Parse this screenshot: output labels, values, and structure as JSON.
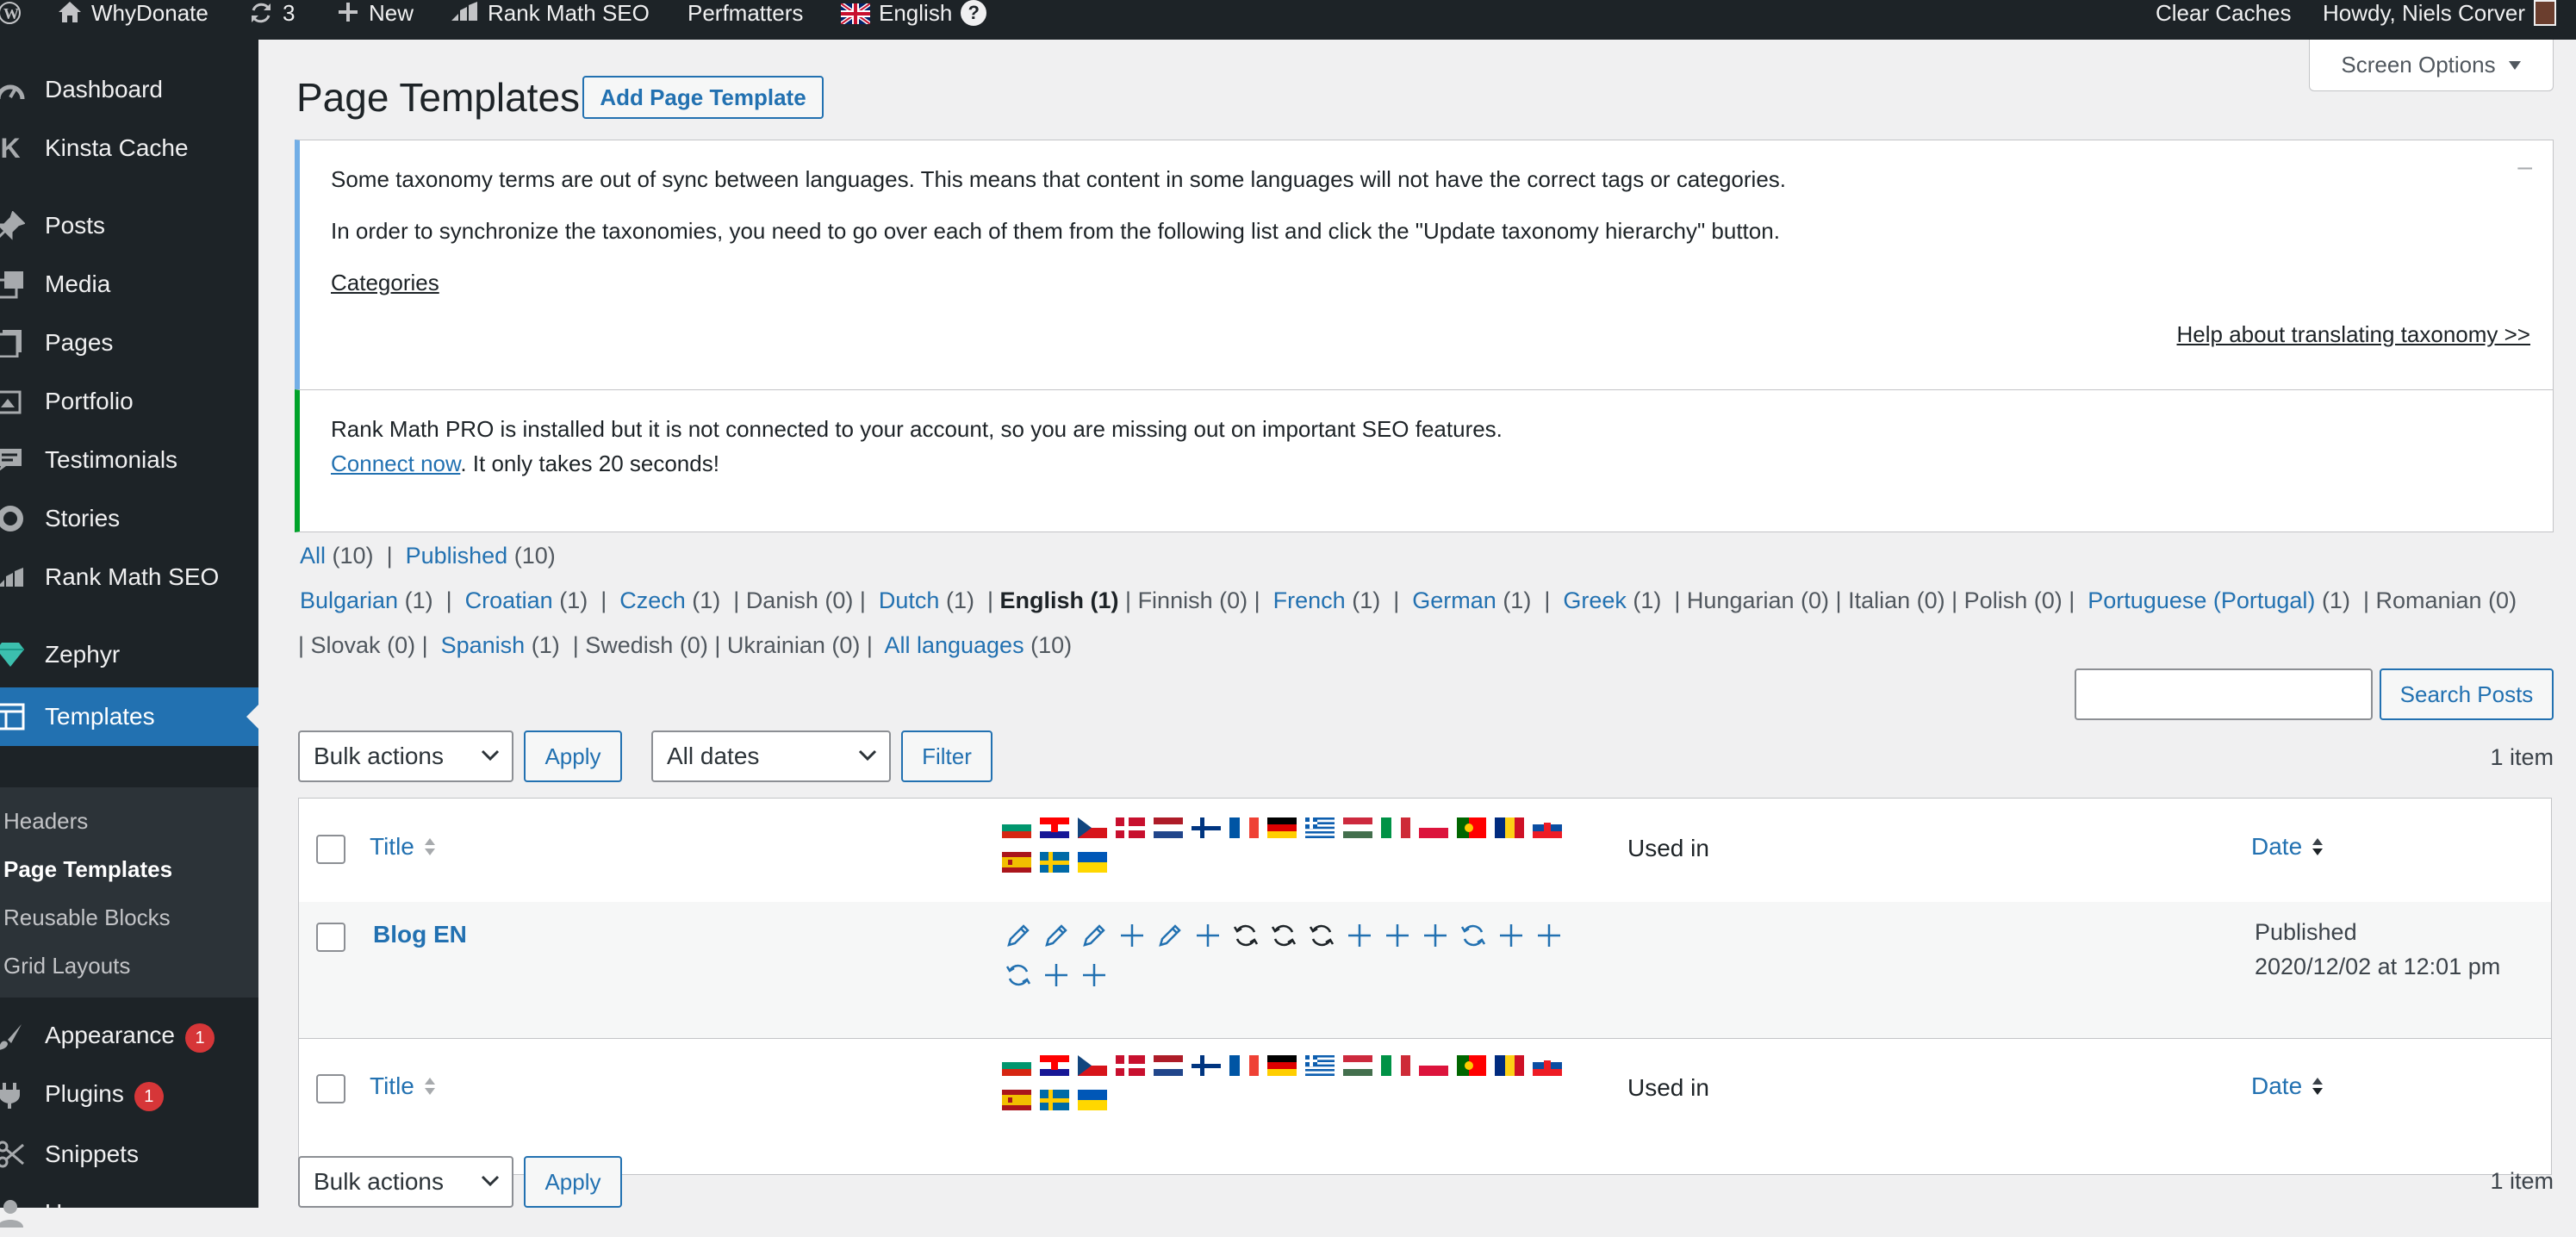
{
  "admin_bar": {
    "site_name": "WhyDonate",
    "updates_count": "3",
    "new_label": "New",
    "rank_math": "Rank Math SEO",
    "perfmatters": "Perfmatters",
    "language": "English",
    "help": "?",
    "clear_caches": "Clear Caches",
    "howdy": "Howdy, Niels Corver"
  },
  "sidebar": {
    "items": [
      {
        "label": "Dashboard",
        "icon": "dashboard-icon"
      },
      {
        "label": "Kinsta Cache",
        "icon": "kinsta-icon"
      },
      {
        "label": "Posts",
        "icon": "pin-icon"
      },
      {
        "label": "Media",
        "icon": "media-icon"
      },
      {
        "label": "Pages",
        "icon": "pages-icon"
      },
      {
        "label": "Portfolio",
        "icon": "portfolio-icon"
      },
      {
        "label": "Testimonials",
        "icon": "testimonial-icon"
      },
      {
        "label": "Stories",
        "icon": "stories-icon"
      },
      {
        "label": "Rank Math SEO",
        "icon": "rankmath-icon"
      },
      {
        "label": "Zephyr",
        "icon": "diamond-icon"
      },
      {
        "label": "Templates",
        "icon": "templates-icon"
      },
      {
        "label": "Appearance",
        "icon": "brush-icon",
        "badge": "1"
      },
      {
        "label": "Plugins",
        "icon": "plug-icon",
        "badge": "1"
      },
      {
        "label": "Snippets",
        "icon": "scissors-icon"
      },
      {
        "label": "Users",
        "icon": "user-icon"
      }
    ],
    "submenu": [
      "Headers",
      "Page Templates",
      "Reusable Blocks",
      "Grid Layouts"
    ]
  },
  "screen_options": "Screen Options",
  "page_title": "Page Templates",
  "add_button": "Add Page Template",
  "taxonomy_notice": {
    "line1": "Some taxonomy terms are out of sync between languages. This means that content in some languages will not have the correct tags or categories.",
    "line2": "In order to synchronize the taxonomies, you need to go over each of them from the following list and click the \"Update taxonomy hierarchy\" button.",
    "categories_link": "Categories",
    "help_link": "Help about translating taxonomy >>",
    "dismiss": "–"
  },
  "rankmath_notice": {
    "line1": "Rank Math PRO is installed but it is not connected to your account, so you are missing out on important SEO features.",
    "connect_link": "Connect now",
    "line2_rest": ". It only takes 20 seconds!"
  },
  "status_filter": {
    "all": "All",
    "all_count": "(10)",
    "sep": "|",
    "published": "Published",
    "published_count": "(10)"
  },
  "languages": [
    {
      "name": "Bulgarian",
      "count": "(1)",
      "link": true
    },
    {
      "name": "Croatian",
      "count": "(1)",
      "link": true
    },
    {
      "name": "Czech",
      "count": "(1)",
      "link": true
    },
    {
      "name": "Danish",
      "count": "(0)",
      "link": false
    },
    {
      "name": "Dutch",
      "count": "(1)",
      "link": true
    },
    {
      "name": "English",
      "count": "(1)",
      "link": false,
      "current": true
    },
    {
      "name": "Finnish",
      "count": "(0)",
      "link": false
    },
    {
      "name": "French",
      "count": "(1)",
      "link": true
    },
    {
      "name": "German",
      "count": "(1)",
      "link": true
    },
    {
      "name": "Greek",
      "count": "(1)",
      "link": true
    },
    {
      "name": "Hungarian",
      "count": "(0)",
      "link": false
    },
    {
      "name": "Italian",
      "count": "(0)",
      "link": false
    },
    {
      "name": "Polish",
      "count": "(0)",
      "link": false
    },
    {
      "name": "Portuguese (Portugal)",
      "count": "(1)",
      "link": true
    },
    {
      "name": "Romanian",
      "count": "(0)",
      "link": false
    },
    {
      "name": "Slovak",
      "count": "(0)",
      "link": false
    },
    {
      "name": "Spanish",
      "count": "(1)",
      "link": true
    },
    {
      "name": "Swedish",
      "count": "(0)",
      "link": false
    },
    {
      "name": "Ukrainian",
      "count": "(0)",
      "link": false
    },
    {
      "name": "All languages",
      "count": "(10)",
      "link": true
    }
  ],
  "search": {
    "value": "",
    "button": "Search Posts"
  },
  "top_nav": {
    "bulk": "Bulk actions",
    "apply": "Apply",
    "dates": "All dates",
    "filter": "Filter",
    "items": "1 item"
  },
  "bottom_nav": {
    "bulk": "Bulk actions",
    "apply": "Apply",
    "items": "1 item"
  },
  "table": {
    "col_title": "Title",
    "col_used_in": "Used in",
    "col_date": "Date",
    "flag_codes": [
      "bg",
      "hr",
      "cz",
      "dk",
      "nl",
      "fi",
      "fr",
      "de",
      "gr",
      "hu",
      "it",
      "pl",
      "pt",
      "ro",
      "sk",
      "es",
      "se",
      "ua"
    ],
    "rows": [
      {
        "title": "Blog EN",
        "status": "Published",
        "date": "2020/12/02 at 12:01 pm",
        "translation_icons": [
          "edit",
          "edit",
          "edit",
          "add",
          "edit",
          "add",
          "sync",
          "sync",
          "sync",
          "add",
          "add",
          "add",
          "refresh",
          "add",
          "add",
          "refresh",
          "add",
          "add"
        ]
      }
    ]
  },
  "colors": {
    "accent": "#2271b1",
    "admin_dark": "#1d2327",
    "badge": "#d63638",
    "notice_info": "#72aee6",
    "notice_success": "#00a32a"
  }
}
